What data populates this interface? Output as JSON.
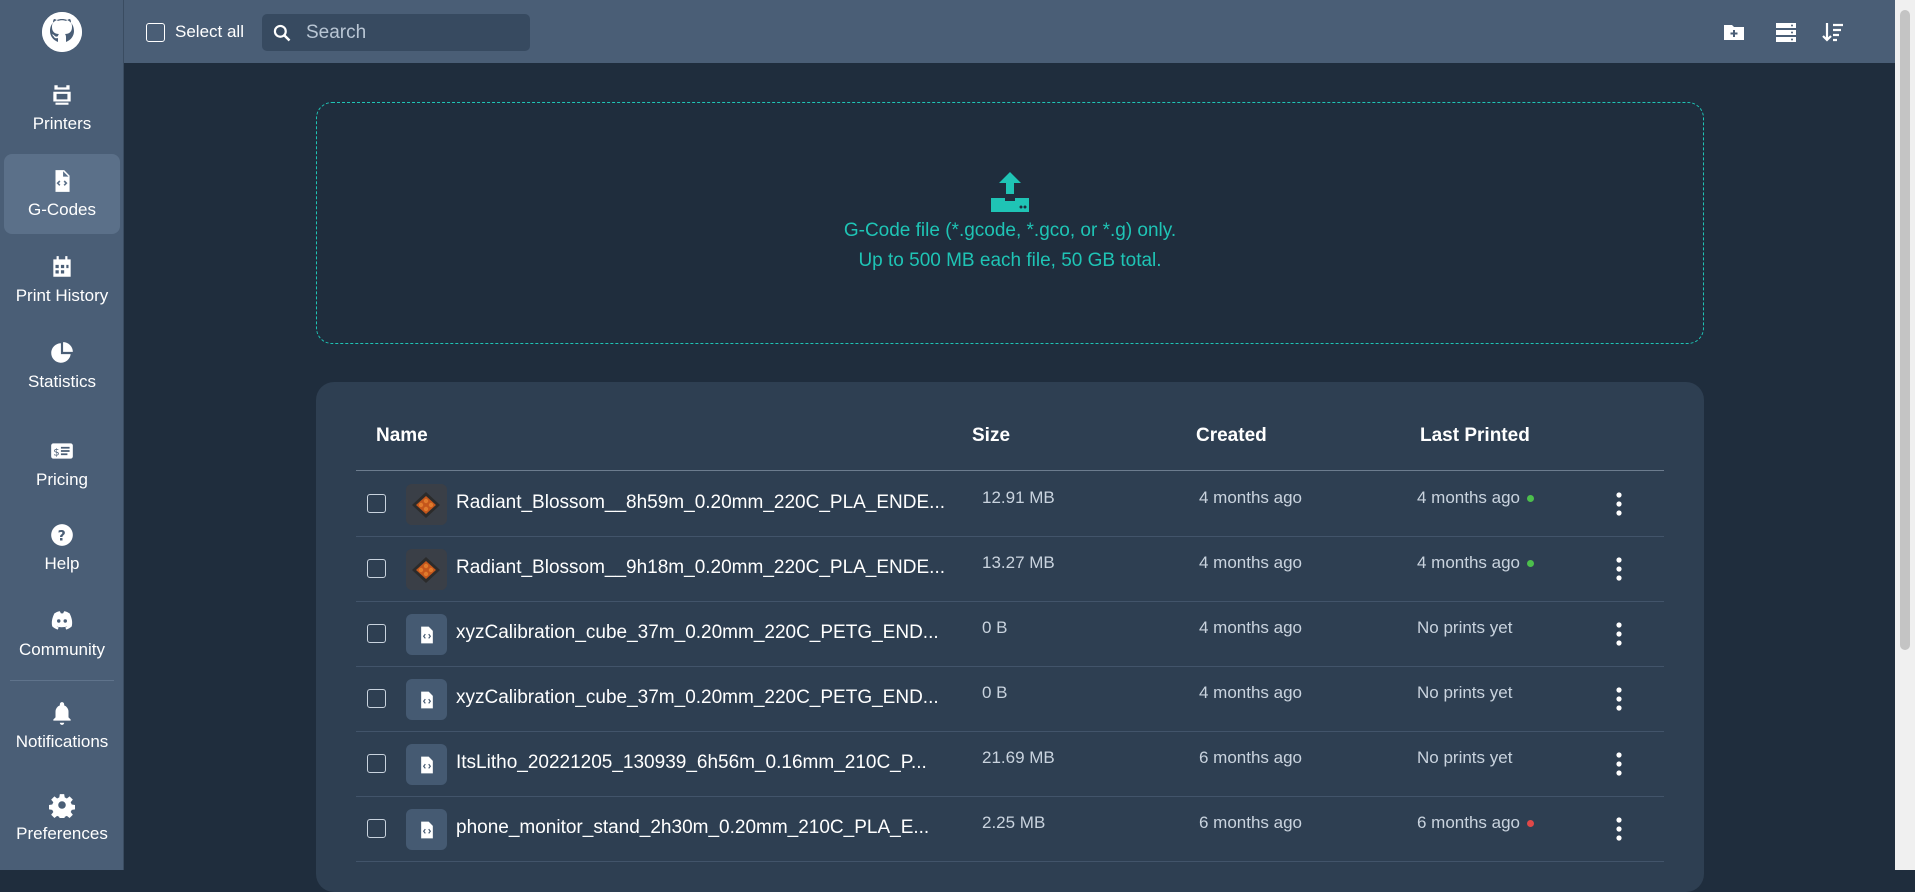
{
  "sidebar": {
    "items": [
      {
        "label": "Printers",
        "icon": "printer-icon"
      },
      {
        "label": "G-Codes",
        "icon": "code-file-icon"
      },
      {
        "label": "Print History",
        "icon": "calendar-icon"
      },
      {
        "label": "Statistics",
        "icon": "pie-chart-icon"
      },
      {
        "label": "Pricing",
        "icon": "money-icon"
      },
      {
        "label": "Help",
        "icon": "help-icon"
      },
      {
        "label": "Community",
        "icon": "discord-icon"
      },
      {
        "label": "Notifications",
        "icon": "bell-icon"
      },
      {
        "label": "Preferences",
        "icon": "gear-icon"
      }
    ],
    "active": "G-Codes"
  },
  "topbar": {
    "select_all_label": "Select all",
    "search_placeholder": "Search",
    "icons": [
      "new-folder-icon",
      "list-view-icon",
      "sort-icon"
    ]
  },
  "dropzone": {
    "line1": "G-Code file (*.gcode, *.gco, or *.g) only.",
    "line2": "Up to 500 MB each file, 50 GB total."
  },
  "table": {
    "columns": {
      "name": "Name",
      "size": "Size",
      "created": "Created",
      "last_printed": "Last Printed"
    },
    "rows": [
      {
        "name": "Radiant_Blossom__8h59m_0.20mm_220C_PLA_ENDE...",
        "size": "12.91 MB",
        "created": "4 months ago",
        "last_printed": "4 months ago",
        "status": "success",
        "thumb": "image"
      },
      {
        "name": "Radiant_Blossom__9h18m_0.20mm_220C_PLA_ENDE...",
        "size": "13.27 MB",
        "created": "4 months ago",
        "last_printed": "4 months ago",
        "status": "success",
        "thumb": "image"
      },
      {
        "name": "xyzCalibration_cube_37m_0.20mm_220C_PETG_END...",
        "size": "0 B",
        "created": "4 months ago",
        "last_printed": "No prints yet",
        "status": "",
        "thumb": "file"
      },
      {
        "name": "xyzCalibration_cube_37m_0.20mm_220C_PETG_END...",
        "size": "0 B",
        "created": "4 months ago",
        "last_printed": "No prints yet",
        "status": "",
        "thumb": "file"
      },
      {
        "name": "ItsLitho_20221205_130939_6h56m_0.16mm_210C_P...",
        "size": "21.69 MB",
        "created": "6 months ago",
        "last_printed": "No prints yet",
        "status": "",
        "thumb": "file"
      },
      {
        "name": "phone_monitor_stand_2h30m_0.20mm_210C_PLA_E...",
        "size": "2.25 MB",
        "created": "6 months ago",
        "last_printed": "6 months ago",
        "status": "failed",
        "thumb": "file"
      }
    ]
  },
  "colors": {
    "accent": "#1fc4b5",
    "success": "#4cbf4c",
    "failed": "#e04848"
  }
}
